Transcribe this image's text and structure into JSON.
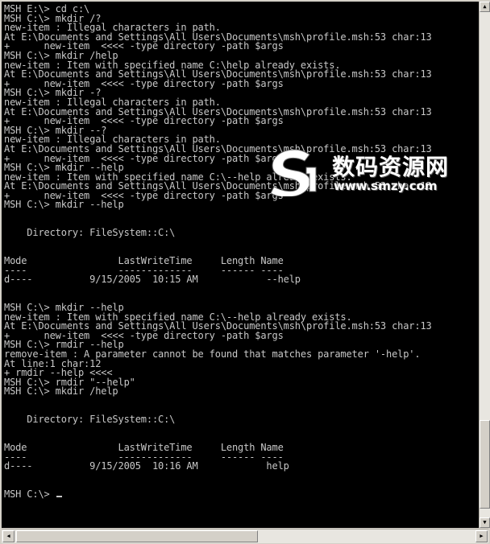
{
  "console": {
    "lines": [
      "MSH E:\\> cd c:\\",
      "MSH C:\\> mkdir /?",
      "new-item : Illegal characters in path.",
      "At E:\\Documents and Settings\\All Users\\Documents\\msh\\profile.msh:53 char:13",
      "+      new-item  <<<< -type directory -path $args",
      "MSH C:\\> mkdir /help",
      "new-item : Item with specified name C:\\help already exists.",
      "At E:\\Documents and Settings\\All Users\\Documents\\msh\\profile.msh:53 char:13",
      "+      new-item  <<<< -type directory -path $args",
      "MSH C:\\> mkdir -?",
      "new-item : Illegal characters in path.",
      "At E:\\Documents and Settings\\All Users\\Documents\\msh\\profile.msh:53 char:13",
      "+      new-item  <<<< -type directory -path $args",
      "MSH C:\\> mkdir --?",
      "new-item : Illegal characters in path.",
      "At E:\\Documents and Settings\\All Users\\Documents\\msh\\profile.msh:53 char:13",
      "+      new-item  <<<< -type directory -path $args",
      "MSH C:\\> mkdir --help",
      "new-item : Item with specified name C:\\--help already exists.",
      "At E:\\Documents and Settings\\All Users\\Documents\\msh\\profile.msh:53 char:13",
      "+      new-item  <<<< -type directory -path $args",
      "MSH C:\\> mkdir --help",
      "",
      "",
      "    Directory: FileSystem::C:\\",
      "",
      "",
      "Mode                LastWriteTime     Length Name",
      "----                -------------     ------ ----",
      "d----          9/15/2005  10:15 AM            --help",
      "",
      "",
      "MSH C:\\> mkdir --help",
      "new-item : Item with specified name C:\\--help already exists.",
      "At E:\\Documents and Settings\\All Users\\Documents\\msh\\profile.msh:53 char:13",
      "+      new-item  <<<< -type directory -path $args",
      "MSH C:\\> rmdir --help",
      "remove-item : A parameter cannot be found that matches parameter '-help'.",
      "At line:1 char:12",
      "+ rmdir --help <<<<",
      "MSH C:\\> rmdir \"--help\"",
      "MSH C:\\> mkdir /help",
      "",
      "",
      "    Directory: FileSystem::C:\\",
      "",
      "",
      "Mode                LastWriteTime     Length Name",
      "----                -------------     ------ ----",
      "d----          9/15/2005  10:16 AM            help",
      "",
      "",
      "MSH C:\\> "
    ]
  },
  "watermark": {
    "title": "数码资源网",
    "url": "www.smzy.com"
  },
  "colors": {
    "console_bg": "#000000",
    "console_fg": "#c8c8c8",
    "chrome": "#d4d0c8"
  }
}
